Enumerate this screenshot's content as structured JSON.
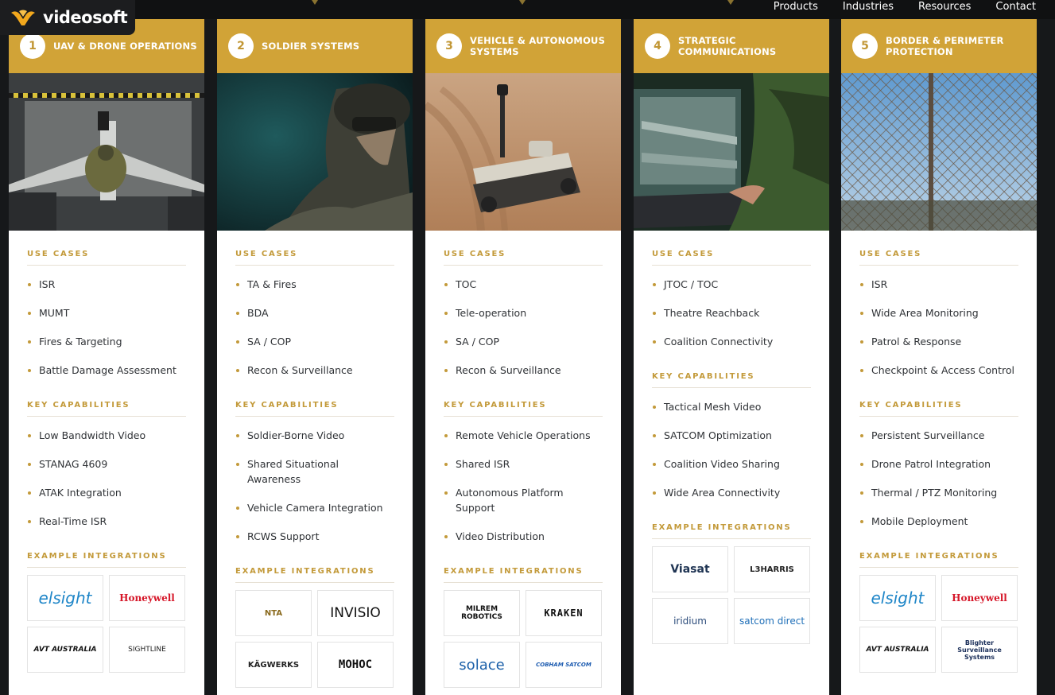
{
  "brand": {
    "name": "videosoft",
    "accent": "#d1a337",
    "logo_color": "#f2a81d"
  },
  "nav": {
    "items": [
      "Products",
      "Industries",
      "Resources",
      "Contact"
    ]
  },
  "columns": [
    {
      "num": "1",
      "title": "UAV & Drone Operations",
      "photo": "drone-operator-photo",
      "use_cases_title": "Use Cases",
      "use_cases": [
        "ISR",
        "MUMT",
        "Fires & Targeting",
        "Battle Damage Assessment"
      ],
      "capabilities_title": "Key Capabilities",
      "capabilities": [
        "Low Bandwidth Video",
        "STANAG 4609",
        "ATAK Integration",
        "Real-Time ISR"
      ],
      "integrations_title": "Example Integrations",
      "integrations": [
        "elsight",
        "Honeywell",
        "AVT AUSTRALIA",
        "SIGHTLINE"
      ]
    },
    {
      "num": "2",
      "title": "Soldier Systems",
      "photo": "soldier-photo",
      "use_cases_title": "Use Cases",
      "use_cases": [
        "TA & Fires",
        "BDA",
        "SA / COP",
        "Recon & Surveillance"
      ],
      "capabilities_title": "Key Capabilities",
      "capabilities": [
        "Soldier-Borne Video",
        "Shared Situational Awareness",
        "Vehicle Camera Integration",
        "RCWS Support"
      ],
      "integrations_title": "Example Integrations",
      "integrations": [
        "NTA",
        "INVISIO",
        "KÄGWERKS",
        "MOHOC"
      ]
    },
    {
      "num": "3",
      "title": "Vehicle & Autonomous Systems",
      "photo": "ground-robot-photo",
      "use_cases_title": "Use Cases",
      "use_cases": [
        "TOC",
        "Tele-operation",
        "SA / COP",
        "Recon & Surveillance"
      ],
      "capabilities_title": "Key Capabilities",
      "capabilities": [
        "Remote Vehicle Operations",
        "Shared ISR",
        "Autonomous Platform Support",
        "Video Distribution"
      ],
      "integrations_title": "Example Integrations",
      "integrations": [
        "MILREM ROBOTICS",
        "KRAKEN",
        "solace",
        "COBHAM SATCOM"
      ]
    },
    {
      "num": "4",
      "title": "Strategic Communications",
      "photo": "laptop-video-photo",
      "use_cases_title": "Use Cases",
      "use_cases": [
        "JTOC / TOC",
        "Theatre Reachback",
        "Coalition Connectivity"
      ],
      "capabilities_title": "Key Capabilities",
      "capabilities": [
        "Tactical Mesh Video",
        "SATCOM Optimization",
        "Coalition Video Sharing",
        "Wide Area Connectivity"
      ],
      "integrations_title": "Example Integrations",
      "integrations": [
        "Viasat",
        "L3HARRIS",
        "iridium",
        "satcom direct"
      ]
    },
    {
      "num": "5",
      "title": "Border & Perimeter Protection",
      "photo": "perimeter-fence-photo",
      "use_cases_title": "Use Cases",
      "use_cases": [
        "ISR",
        "Wide Area Monitoring",
        "Patrol & Response",
        "Checkpoint & Access Control"
      ],
      "capabilities_title": "Key Capabilities",
      "capabilities": [
        "Persistent Surveillance",
        "Drone Patrol Integration",
        "Thermal / PTZ Monitoring",
        "Mobile Deployment"
      ],
      "integrations_title": "Example Integrations",
      "integrations": [
        "elsight",
        "Honeywell",
        "AVT AUSTRALIA",
        "Blighter Surveillance Systems"
      ]
    }
  ]
}
